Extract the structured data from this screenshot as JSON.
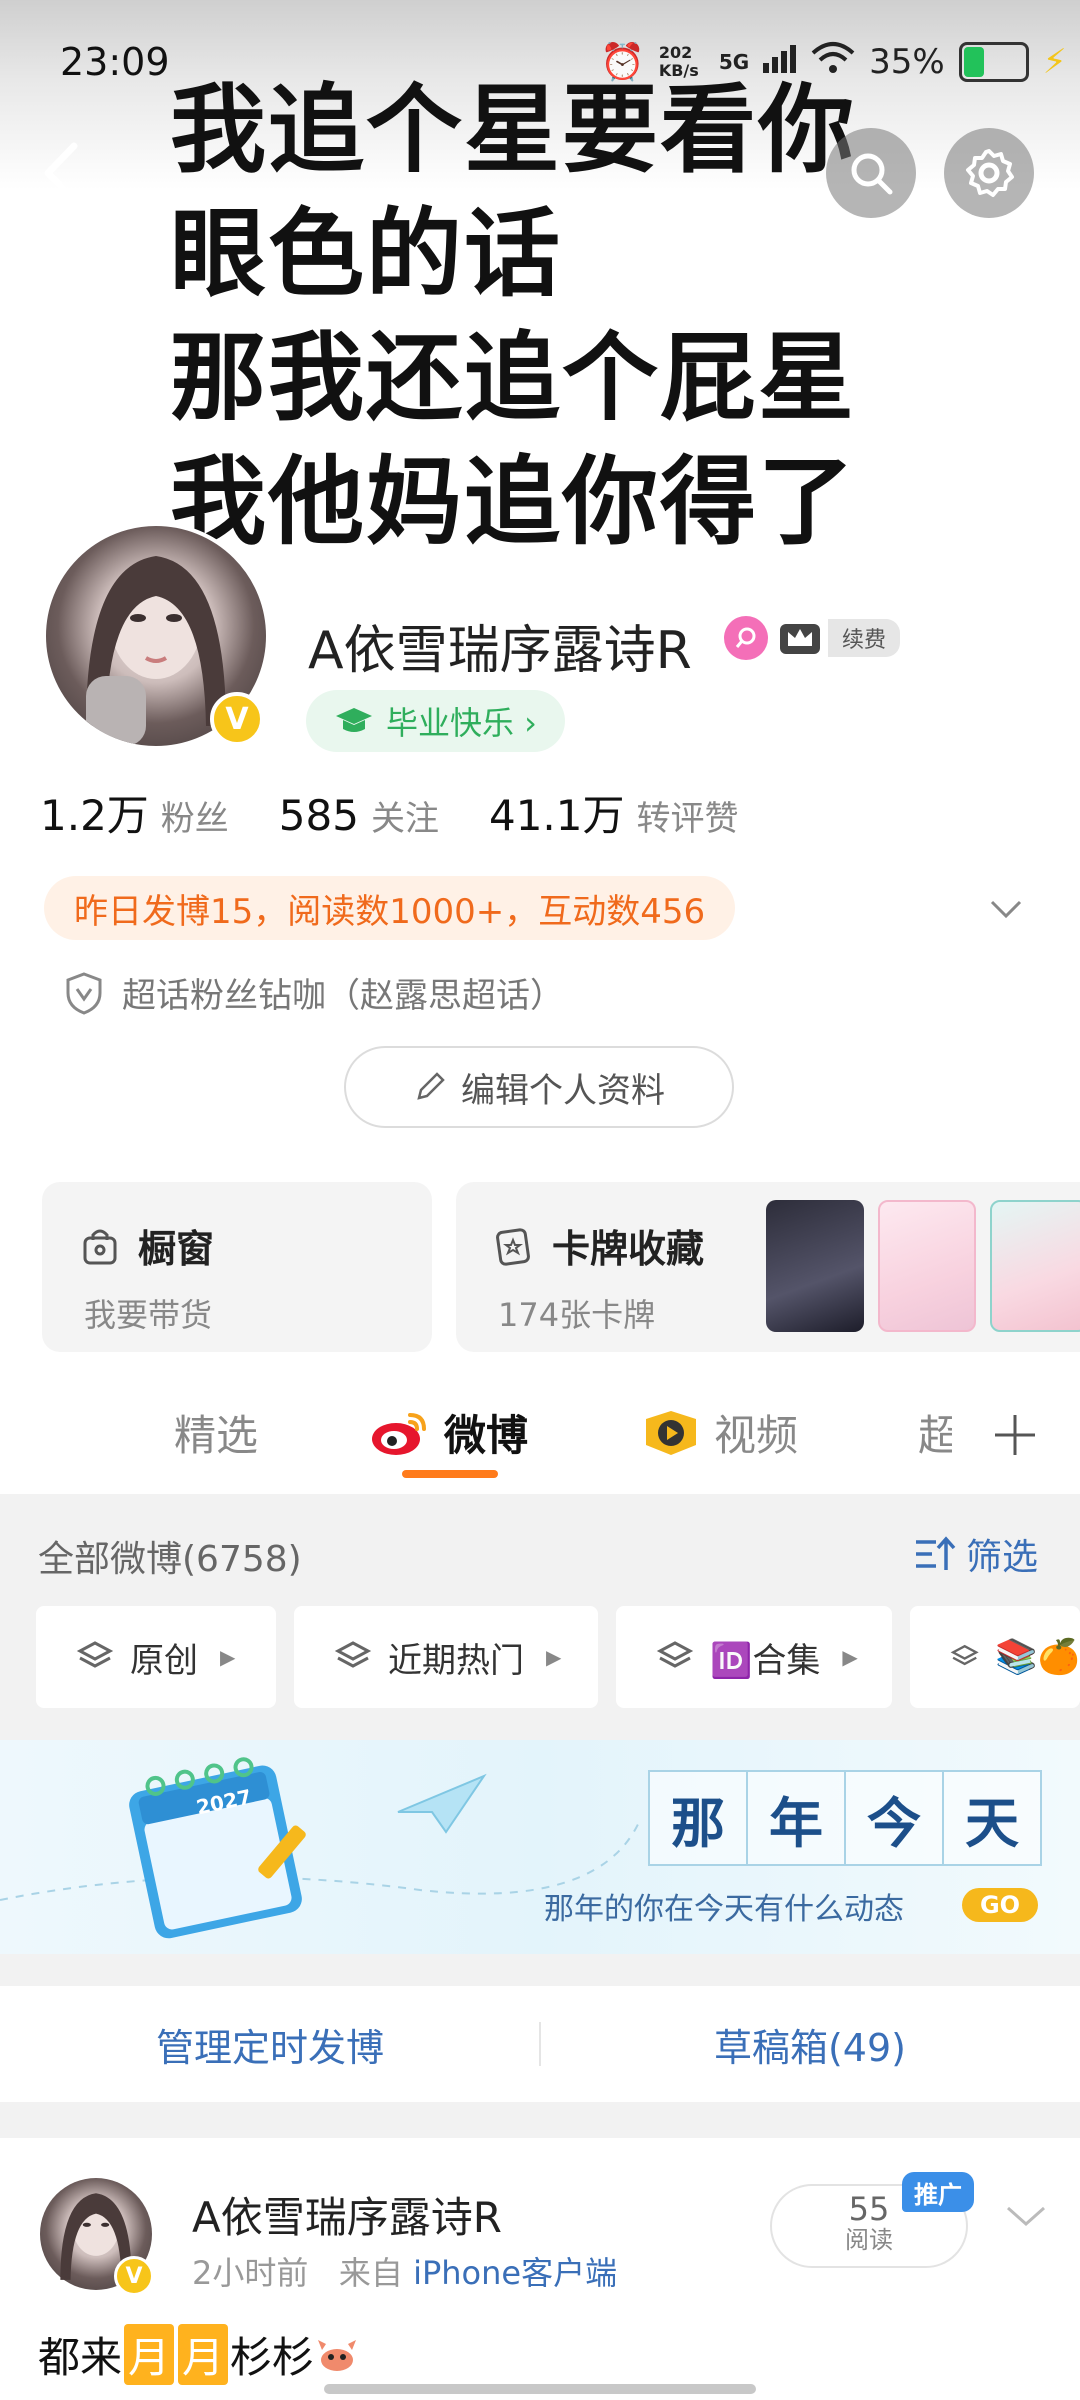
{
  "status_bar": {
    "time": "23:09",
    "net_speed": "202 KB/s",
    "signal": "5G",
    "battery": "35%",
    "battery_level": 0.35
  },
  "banner": {
    "lines": [
      "我追个星要看你",
      "眼色的话",
      "那我还追个屁星",
      "我他妈追你得了"
    ]
  },
  "profile": {
    "nickname": "A依雪瑞序露诗R",
    "vip_label": "续费",
    "verified_badge": "V",
    "graduation_tag": "毕业快乐 ›",
    "stats": [
      {
        "value": "1.2万",
        "label": "粉丝"
      },
      {
        "value": "585",
        "label": "关注"
      },
      {
        "value": "41.1万",
        "label": "转评赞"
      }
    ],
    "yesterday_summary": "昨日发博15，阅读数1000+，互动数456",
    "supertopic": "超话粉丝钻咖（赵露思超话）",
    "edit_button": "编辑个人资料"
  },
  "cards": {
    "shop": {
      "title": "橱窗",
      "subtitle": "我要带货"
    },
    "collection": {
      "title": "卡牌收藏",
      "subtitle": "174张卡牌"
    }
  },
  "tabs": [
    {
      "label": "精选"
    },
    {
      "label": "微博",
      "active": true
    },
    {
      "label": "视频"
    },
    {
      "label": "超"
    }
  ],
  "feed_header": {
    "all_label": "全部微博(6758)",
    "filter_label": "筛选"
  },
  "chips": [
    {
      "label": "原创"
    },
    {
      "label": "近期热门"
    },
    {
      "label": "🆔合集"
    },
    {
      "label": "📚🍊"
    }
  ],
  "memory": {
    "year": "2027",
    "chars": [
      "那",
      "年",
      "今",
      "天"
    ],
    "subtitle": "那年的你在今天有什么动态",
    "go": "GO"
  },
  "manage": {
    "scheduled": "管理定时发博",
    "drafts": "草稿箱(49)"
  },
  "post": {
    "name": "A依雪瑞序露诗R",
    "time": "2小时前",
    "from": "来自",
    "source": "iPhone客户端",
    "reads": "55",
    "reads_label": "阅读",
    "promote": "推广",
    "text_before": "都来",
    "text_hl1": "月",
    "text_hl2": "月",
    "text_after": "杉杉"
  },
  "colors": {
    "accent": "#ff7b1b",
    "link": "#3a6fb8",
    "vip_gold": "#f7c51a",
    "green": "#2fae5c"
  }
}
